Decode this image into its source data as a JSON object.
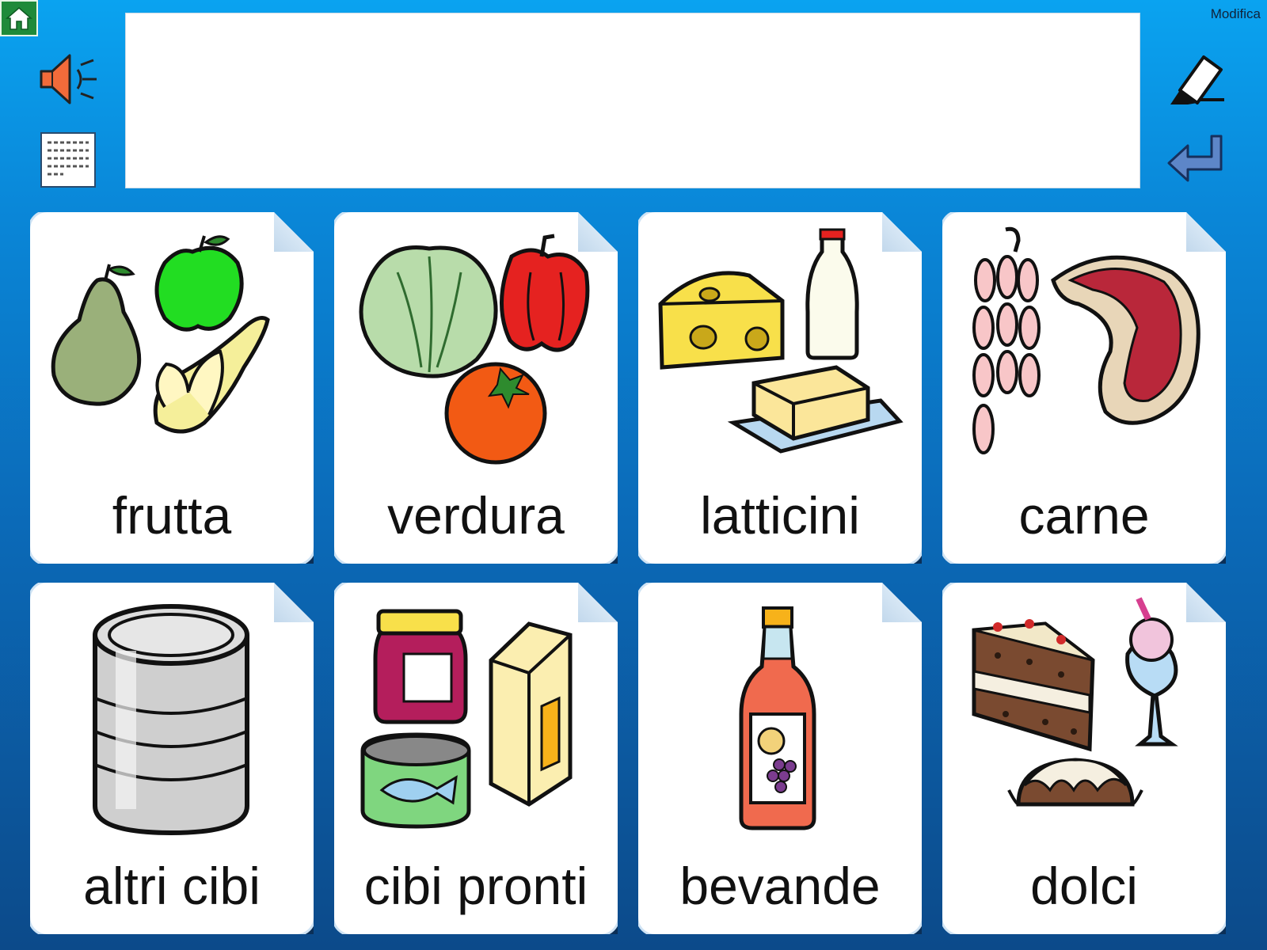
{
  "header": {
    "edit_label": "Modifica",
    "home_icon": "home-icon"
  },
  "message_bar": {
    "value": ""
  },
  "toolbar": {
    "speak_icon": "speaker-icon",
    "keyboard_icon": "keyboard-icon",
    "clear_icon": "eraser-icon",
    "enter_icon": "return-arrow-icon"
  },
  "categories": [
    {
      "label": "frutta",
      "icon": "fruit-icon"
    },
    {
      "label": "verdura",
      "icon": "vegetables-icon"
    },
    {
      "label": "latticini",
      "icon": "dairy-icon"
    },
    {
      "label": "carne",
      "icon": "meat-icon"
    },
    {
      "label": "altri cibi",
      "icon": "can-icon"
    },
    {
      "label": "cibi pronti",
      "icon": "ready-food-icon"
    },
    {
      "label": "bevande",
      "icon": "bottle-icon"
    },
    {
      "label": "dolci",
      "icon": "sweets-icon"
    }
  ],
  "colors": {
    "accent": "#0a87d8",
    "home_green": "#1f8a3a",
    "card_bg": "#ffffff"
  }
}
